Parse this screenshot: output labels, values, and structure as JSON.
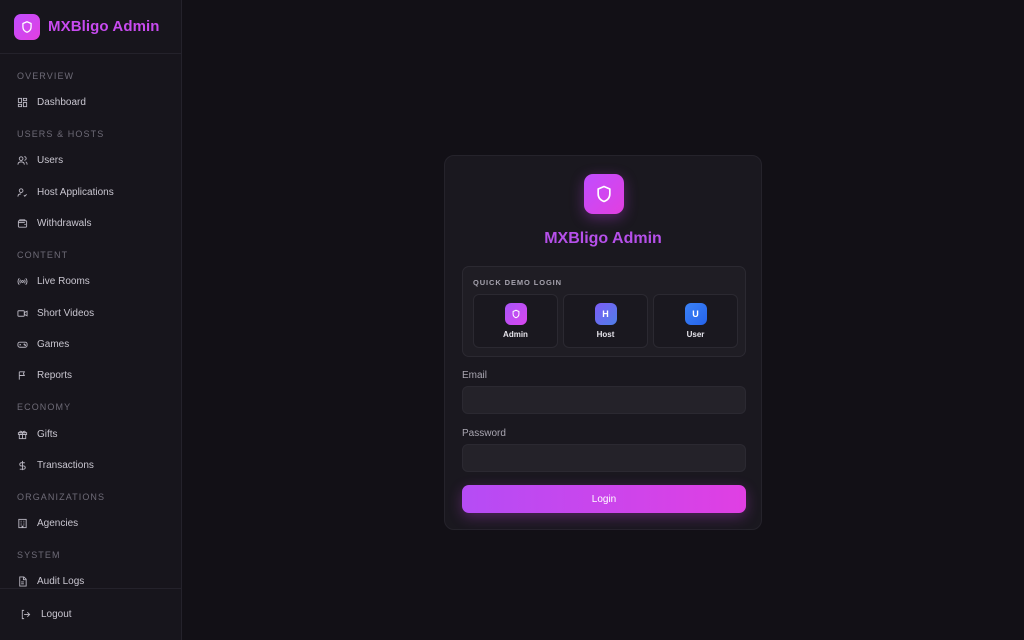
{
  "app": {
    "title": "MXBligo Admin"
  },
  "sidebar": {
    "sections": [
      {
        "title": "OVERVIEW",
        "items": [
          {
            "label": "Dashboard",
            "icon": "dashboard-icon"
          }
        ]
      },
      {
        "title": "USERS & HOSTS",
        "items": [
          {
            "label": "Users",
            "icon": "users-icon"
          },
          {
            "label": "Host Applications",
            "icon": "user-check-icon"
          },
          {
            "label": "Withdrawals",
            "icon": "wallet-icon"
          }
        ]
      },
      {
        "title": "CONTENT",
        "items": [
          {
            "label": "Live Rooms",
            "icon": "broadcast-icon"
          },
          {
            "label": "Short Videos",
            "icon": "video-icon"
          },
          {
            "label": "Games",
            "icon": "gamepad-icon"
          },
          {
            "label": "Reports",
            "icon": "flag-icon"
          }
        ]
      },
      {
        "title": "ECONOMY",
        "items": [
          {
            "label": "Gifts",
            "icon": "gift-icon"
          },
          {
            "label": "Transactions",
            "icon": "dollar-icon"
          }
        ]
      },
      {
        "title": "ORGANIZATIONS",
        "items": [
          {
            "label": "Agencies",
            "icon": "building-icon"
          }
        ]
      },
      {
        "title": "SYSTEM",
        "items": [
          {
            "label": "Audit Logs",
            "icon": "file-icon"
          }
        ]
      }
    ],
    "logout_label": "Logout"
  },
  "login": {
    "title": "MXBligo Admin",
    "demo_title": "QUICK DEMO LOGIN",
    "demo_accounts": [
      {
        "name": "Admin",
        "avatar": "",
        "colors": [
          "#a855f7",
          "#d946ef"
        ]
      },
      {
        "name": "Host",
        "avatar": "H",
        "colors": [
          "#7c5cf6",
          "#4f7fe8"
        ]
      },
      {
        "name": "User",
        "avatar": "U",
        "colors": [
          "#3b82f6",
          "#2563eb"
        ]
      }
    ],
    "email_label": "Email",
    "email_value": "",
    "password_label": "Password",
    "password_value": "",
    "submit_label": "Login"
  },
  "colors": {
    "accent": "#c84bf0",
    "background": "#121016",
    "sidebar": "#17151c"
  }
}
